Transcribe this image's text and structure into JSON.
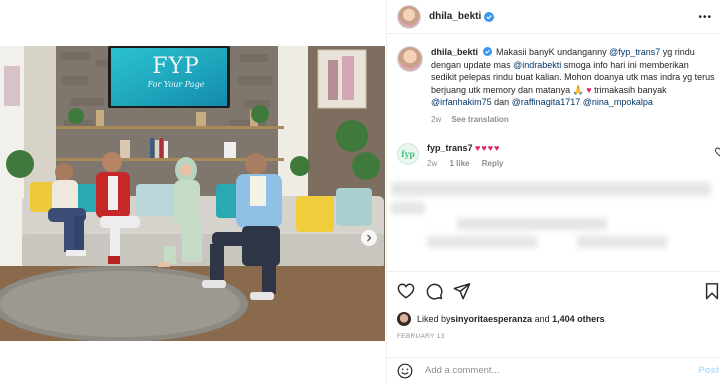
{
  "post": {
    "username": "dhila_bekti",
    "caption_user": "dhila_bekti",
    "caption_segments": [
      {
        "t": "Makasii banyK undanganny ",
        "m": false
      },
      {
        "t": "@fyp_trans7",
        "m": true
      },
      {
        "t": " yg rindu dengan update mas ",
        "m": false
      },
      {
        "t": "@indrabekti",
        "m": true
      },
      {
        "t": " smoga info hari ini memberikan sedikit pelepas rindu buat kalian. Mohon doanya utk mas indra yg terus berjuang utk memory dan matanya 🙏 ",
        "m": false
      },
      {
        "t": "♥",
        "m": false
      },
      {
        "t": " trimakasih banyak ",
        "m": false
      },
      {
        "t": "@irfanhakim75",
        "m": true
      },
      {
        "t": " dan ",
        "m": false
      },
      {
        "t": "@raffinagita1717",
        "m": true
      },
      {
        "t": " ",
        "m": false
      },
      {
        "t": "@nina_mpokalpa",
        "m": true
      }
    ],
    "caption_age": "2w",
    "see_translation": "See translation",
    "likes_by_prefix": "Liked by ",
    "likes_by_user": "sinyoritaesperanza",
    "likes_and": " and ",
    "likes_count": "1,404 others",
    "date": "FEBRUARY 13",
    "add_comment_placeholder": "Add a comment...",
    "post_button": "Post"
  },
  "comment": {
    "username": "fyp_trans7",
    "avatar_text": "fyp",
    "text": "♥♥♥♥",
    "age": "2w",
    "likes": "1 like",
    "reply": "Reply"
  },
  "photo": {
    "show_title": "FYP",
    "show_subtitle": "For Your Page"
  },
  "colors": {
    "mention": "#00376b",
    "secondary": "#8e8e8e",
    "verified": "#3897f0",
    "heart": "#e0245e"
  }
}
